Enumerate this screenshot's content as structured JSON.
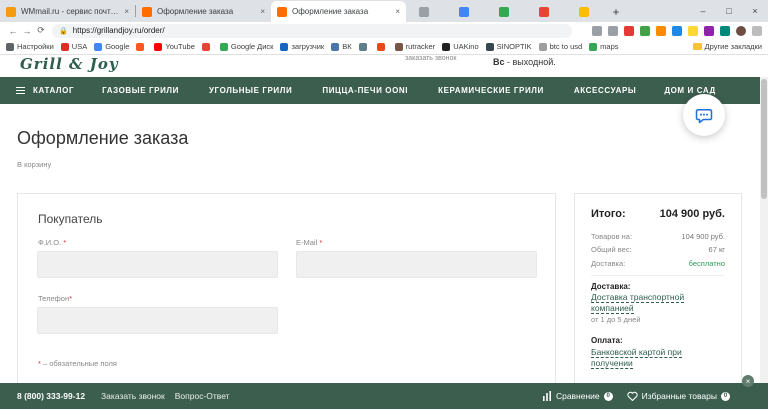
{
  "browser": {
    "tabs": [
      {
        "title": "WMmail.ru - сервис почтовых ра",
        "favicon_color": "#f39c12",
        "active": false
      },
      {
        "title": "Оформление заказа",
        "favicon_color": "#ff6d00",
        "active": false
      },
      {
        "title": "Оформление заказа",
        "favicon_color": "#ff6d00",
        "active": true
      }
    ],
    "close_glyph": "×",
    "new_tab_glyph": "+",
    "window_controls": [
      "–",
      "□",
      "×"
    ],
    "url": "https://grillandjoy.ru/order/",
    "bookmarks": [
      {
        "label": "Настройки",
        "color": "#5f6368"
      },
      {
        "label": "USA",
        "color": "#d93025"
      },
      {
        "label": "Google",
        "color": "#4285f4"
      },
      {
        "label": "",
        "color": "#ff5722"
      },
      {
        "label": "YouTube",
        "color": "#ff0000"
      },
      {
        "label": "",
        "color": "#ea4335"
      },
      {
        "label": "Google Диск",
        "color": "#34a853"
      },
      {
        "label": "загрузчик",
        "color": "#1565c0"
      },
      {
        "label": "ВК",
        "color": "#4a76a8"
      },
      {
        "label": "",
        "color": "#607d8b"
      },
      {
        "label": "",
        "color": "#e64a19"
      },
      {
        "label": "rutracker",
        "color": "#795548"
      },
      {
        "label": "UAKino",
        "color": "#212121"
      },
      {
        "label": "SINOPTIK",
        "color": "#37474f"
      },
      {
        "label": "btc to usd",
        "color": "#9e9e9e"
      },
      {
        "label": "maps",
        "color": "#34a853"
      }
    ],
    "other_bookmarks": "Другие закладки"
  },
  "site": {
    "logo_text": "Grill & Joy",
    "head_note": "заказать звонок",
    "hours_day": "Вс",
    "hours_text": " - выходной.",
    "menu": [
      "КАТАЛОГ",
      "ГАЗОВЫЕ ГРИЛИ",
      "УГОЛЬНЫЕ ГРИЛИ",
      "ПИЦЦА-ПЕЧИ OONI",
      "КЕРАМИЧЕСКИЕ ГРИЛИ",
      "АКСЕССУАРЫ",
      "ДОМ И САД"
    ]
  },
  "order": {
    "title": "Оформление заказа",
    "back_link": "В корзину",
    "buyer_heading": "Покупатель",
    "fields": {
      "fio_label": "Ф.И.О.",
      "email_label": "E-Mail",
      "phone_label": "Телефон",
      "required_mark": "*"
    },
    "required_note": " – обязательные поля"
  },
  "summary": {
    "total_label": "Итого:",
    "total_value": "104 900 руб.",
    "rows": [
      {
        "label": "Товаров на:",
        "value": "104 900 руб."
      },
      {
        "label": "Общий вес:",
        "value": "67 кг"
      },
      {
        "label": "Доставка:",
        "value": "бесплатно"
      }
    ],
    "delivery_heading": "Доставка:",
    "delivery_link": "Доставка транспортной компанией",
    "delivery_term": "от 1 до 5 дней",
    "payment_heading": "Оплата:",
    "payment_link": "Банковской картой при получении"
  },
  "footer_bar": {
    "phone": "8 (800) 333-99-12",
    "call_link": "Заказать звонок",
    "faq_link": "Вопрос-Ответ",
    "compare_label": "Сравнение",
    "compare_count": "0",
    "favorites_label": "Избранные товары",
    "favorites_count": "0",
    "close_glyph": "×"
  },
  "colors": {
    "brand_green": "#3c5e4f",
    "free_green": "#2f9b5a",
    "required_red": "#e0312f",
    "chat_icon_blue": "#1e6fd9"
  }
}
